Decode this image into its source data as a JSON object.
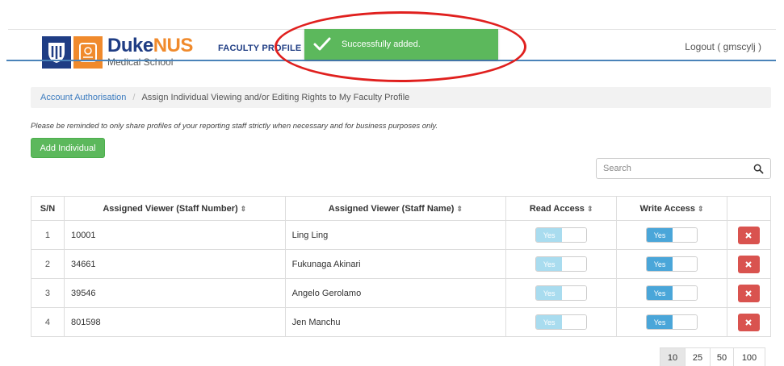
{
  "header": {
    "logo_brand_duke": "Duke",
    "logo_brand_nus": "NUS",
    "logo_subtitle": "Medical School",
    "nav_faculty_profile": "FACULTY PROFILE",
    "logout_label": "Logout ( gmscylj )"
  },
  "toast": {
    "message": "Successfully added.",
    "color": "#5cb85c"
  },
  "breadcrumb": {
    "root": "Account Authorisation",
    "separator": "/",
    "current": "Assign Individual Viewing and/or Editing Rights to My Faculty Profile"
  },
  "notice": "Please be reminded to only share profiles of your reporting staff strictly when necessary and for business purposes only.",
  "add_button_label": "Add Individual",
  "search": {
    "placeholder": "Search",
    "icon": "search-icon"
  },
  "table": {
    "columns": {
      "sn": "S/N",
      "staff_number": "Assigned Viewer (Staff Number)",
      "staff_name": "Assigned Viewer (Staff Name)",
      "read_access": "Read Access",
      "write_access": "Write Access"
    },
    "sort_glyph": "⇕",
    "rows": [
      {
        "sn": "1",
        "staff_number": "10001",
        "staff_name": "Ling Ling",
        "read": "Yes",
        "write": "Yes"
      },
      {
        "sn": "2",
        "staff_number": "34661",
        "staff_name": "Fukunaga Akinari",
        "read": "Yes",
        "write": "Yes"
      },
      {
        "sn": "3",
        "staff_number": "39546",
        "staff_name": "Angelo Gerolamo",
        "read": "Yes",
        "write": "Yes"
      },
      {
        "sn": "4",
        "staff_number": "801598",
        "staff_name": "Jen Manchu",
        "read": "Yes",
        "write": "Yes"
      }
    ]
  },
  "pagination": {
    "sizes": [
      "10",
      "25",
      "50",
      "100"
    ],
    "selected": "10"
  },
  "colors": {
    "primary_navy": "#1f3d84",
    "accent_orange": "#f08a2c",
    "success": "#5cb85c",
    "danger": "#d9534f",
    "toggle_on": "#4aa6d9",
    "toggle_disabled": "#a9dcef",
    "annotation_red": "#e0201e"
  }
}
